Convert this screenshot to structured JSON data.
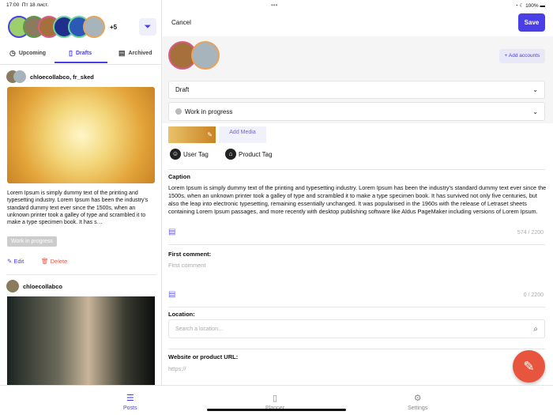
{
  "status": {
    "time": "17:00",
    "date": "Пт 18 лист.",
    "battery": "100%"
  },
  "left": {
    "more_accounts": "+5",
    "tabs": [
      {
        "label": "Upcoming"
      },
      {
        "label": "Drafts"
      },
      {
        "label": "Archived"
      }
    ],
    "posts": [
      {
        "accounts": "chloecollabco, fr_sked",
        "text": "Lorem Ipsum is simply dummy text of the printing and typesetting industry. Lorem Ipsum has been the industry's standard dummy text ever since the 1500s, when an unknown printer took a galley of type and scrambled it to make a type specimen book. It has s…",
        "status": "Work in progress",
        "edit": "Edit",
        "delete": "Delete"
      },
      {
        "accounts": "chloecollabco"
      }
    ]
  },
  "right": {
    "cancel": "Cancel",
    "save": "Save",
    "add_accounts": "+ Add accounts",
    "draft_select": "Draft",
    "status_select": "Work in progress",
    "add_media": "Add Media",
    "user_tag": "User Tag",
    "product_tag": "Product Tag",
    "caption_label": "Caption",
    "caption": "Lorem Ipsum is simply dummy text of the printing and typesetting industry. Lorem Ipsum has been the industry's standard dummy text ever since the 1500s, when an unknown printer took a galley of type and scrambled it to make a type specimen book. It has survived not only five centuries, but also the leap into electronic typesetting, remaining essentially unchanged. It was popularised in the 1960s with the release of Letraset sheets containing Lorem Ipsum passages, and more recently with desktop publishing software like Aldus PageMaker including versions of Lorem Ipsum.",
    "caption_count": "574 / 2200",
    "first_comment_label": "First comment:",
    "first_comment_placeholder": "First comment",
    "comment_count": "0 / 2200",
    "location_label": "Location:",
    "location_placeholder": "Search a location...",
    "url_label": "Website or product URL:",
    "url_placeholder": "https://"
  },
  "bottom_nav": [
    {
      "label": "Posts"
    },
    {
      "label": "Planner"
    },
    {
      "label": "Settings"
    }
  ],
  "colors": {
    "accent": "#4a3ee6",
    "fab": "#e8553f"
  }
}
